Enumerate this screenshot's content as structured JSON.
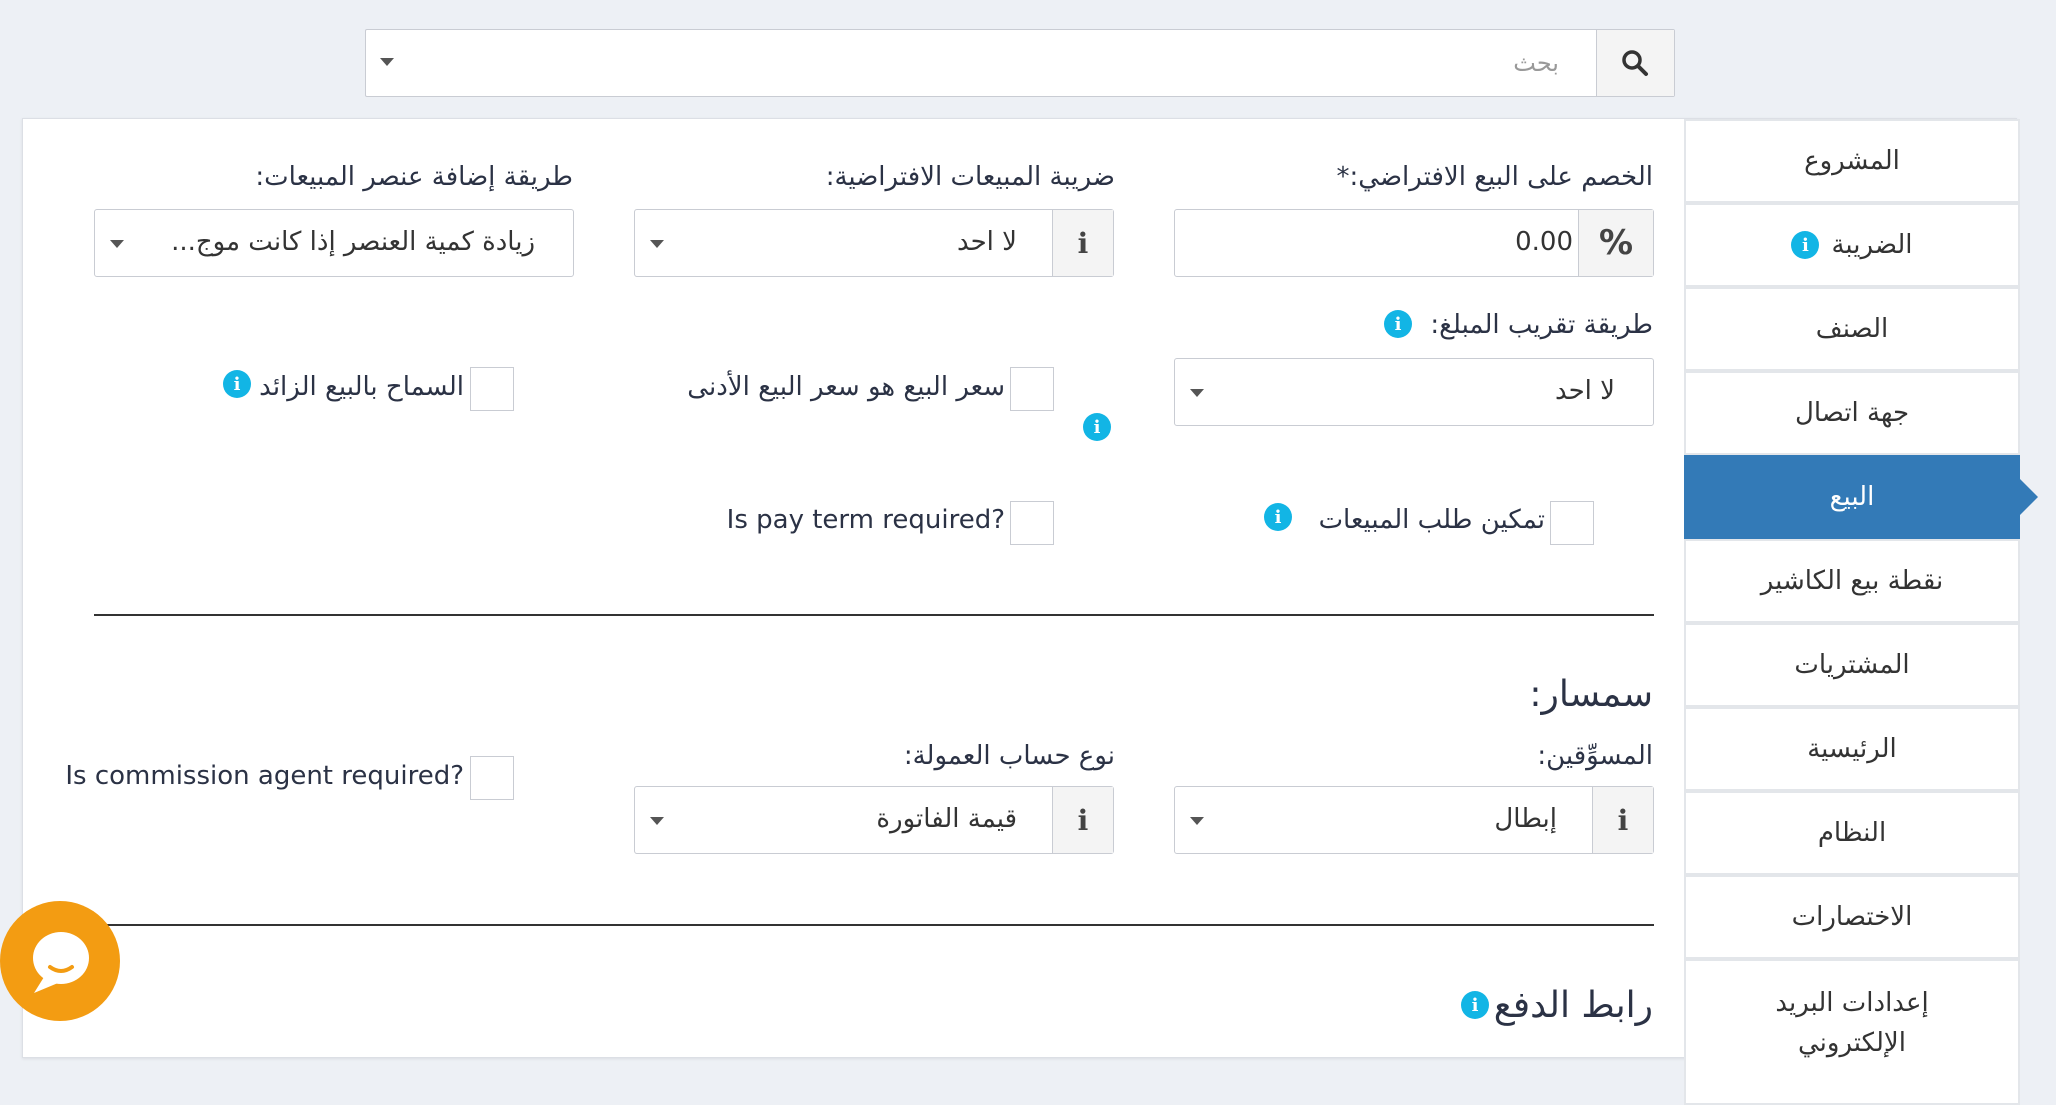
{
  "search": {
    "placeholder": "بحث",
    "icon": "search-icon"
  },
  "sidebar": {
    "items": [
      {
        "label": "المشروع"
      },
      {
        "label": "الضريبة"
      },
      {
        "label": "الصنف"
      },
      {
        "label": "جهة اتصال"
      },
      {
        "label": "البيع"
      },
      {
        "label": "نقطة بيع الكاشير"
      },
      {
        "label": "المشتريات"
      },
      {
        "label": "الرئيسية"
      },
      {
        "label": "النظام"
      },
      {
        "label": "الاختصارات"
      },
      {
        "label": "إعدادات البريد الإلكتروني"
      }
    ],
    "active_index": 4
  },
  "sale": {
    "default_discount": {
      "label": "الخصم على البيع الافتراضي:*",
      "value": "0.00",
      "addon": "%"
    },
    "default_tax": {
      "label": "ضريبة المبيعات الافتراضية:",
      "value": "لا احد"
    },
    "add_item_method": {
      "label": "طريقة إضافة عنصر المبيعات:",
      "value": "زيادة كمية العنصر إذا كانت موج..."
    },
    "rounding_method": {
      "label": "طريقة تقريب المبلغ:",
      "value": "لا احد"
    },
    "min_sell_price": {
      "label": "سعر البيع هو سعر البيع الأدنى"
    },
    "allow_overselling": {
      "label": "السماح بالبيع الزائد"
    },
    "enable_sales_order": {
      "label": "تمكين طلب المبيعات"
    },
    "pay_term_required": {
      "label": "Is pay term required?"
    }
  },
  "commission": {
    "heading": "سمسار:",
    "agents": {
      "label": "المسوِّقين:",
      "value": "إبطال"
    },
    "calc_type": {
      "label": "نوع حساب العمولة:",
      "value": "قيمة الفاتورة"
    },
    "agent_required": {
      "label": "Is commission agent required?"
    }
  },
  "payment_link": {
    "heading": "رابط الدفع :"
  },
  "colors": {
    "accent": "#337ab7",
    "info": "#12b5e5",
    "chat": "#f39c12"
  }
}
